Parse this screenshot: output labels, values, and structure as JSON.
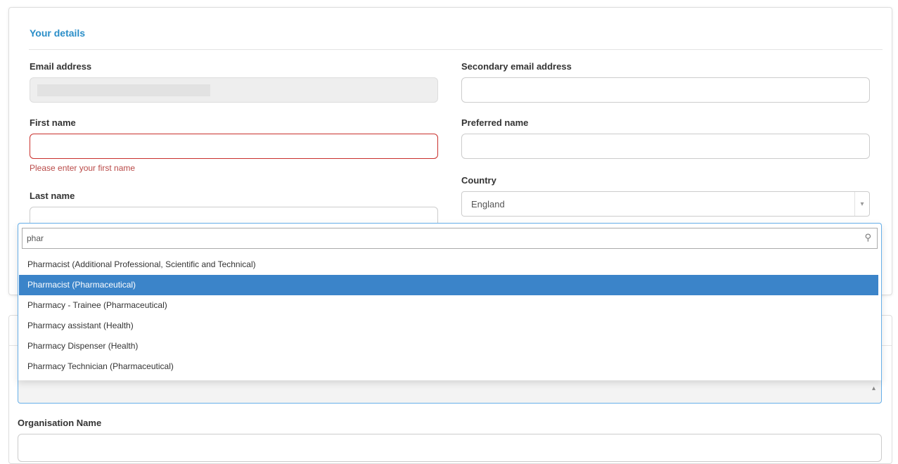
{
  "details": {
    "heading": "Your details",
    "email_label": "Email address",
    "secondary_email_label": "Secondary email address",
    "first_name_label": "First name",
    "first_name_error": "Please enter your first name",
    "preferred_name_label": "Preferred name",
    "last_name_label": "Last name",
    "country_label": "Country",
    "country_value": "England"
  },
  "job_role_dropdown": {
    "search_value": "phar",
    "options": [
      "Pharmacist (Additional Professional, Scientific and Technical)",
      "Pharmacist (Pharmaceutical)",
      "Pharmacy - Trainee (Pharmaceutical)",
      "Pharmacy assistant (Health)",
      "Pharmacy Dispenser (Health)",
      "Pharmacy Technician (Pharmaceutical)"
    ],
    "highlighted_option": "Pharmacist (Pharmaceutical)"
  },
  "organisation": {
    "label": "Organisation Name"
  },
  "colors": {
    "accent": "#2a8ec8",
    "highlight": "#3b84c9",
    "error": "#b94a48",
    "focus_border": "#66afe9"
  },
  "icons": {
    "search": "search-icon",
    "select_arrow": "chevron-down-icon"
  }
}
